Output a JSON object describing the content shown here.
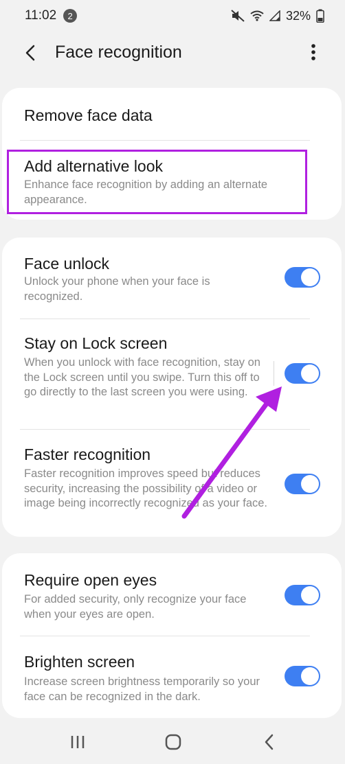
{
  "status_bar": {
    "time": "11:02",
    "notification_count": "2",
    "battery": "32%"
  },
  "app_bar": {
    "title": "Face recognition"
  },
  "card1": {
    "remove_face_data": {
      "title": "Remove face data"
    },
    "add_alternative_look": {
      "title": "Add alternative look",
      "subtitle": "Enhance face recognition by adding an alternate appearance."
    }
  },
  "card2": {
    "face_unlock": {
      "title": "Face unlock",
      "subtitle": "Unlock your phone when your face is recognized.",
      "enabled": true
    },
    "stay_on_lock_screen": {
      "title": "Stay on Lock screen",
      "subtitle": "When you unlock with face recognition, stay on the Lock screen until you swipe. Turn this off to go directly to the last screen you were using.",
      "enabled": true
    },
    "faster_recognition": {
      "title": "Faster recognition",
      "subtitle": "Faster recognition improves speed but reduces security, increasing the possibility of a video or image being incorrectly recognized as your face.",
      "enabled": true
    }
  },
  "card3": {
    "require_open_eyes": {
      "title": "Require open eyes",
      "subtitle": "For added security, only recognize your face when your eyes are open.",
      "enabled": true
    },
    "brighten_screen": {
      "title": "Brighten screen",
      "subtitle": "Increase screen brightness temporarily so your face can be recognized in the dark.",
      "enabled": true
    }
  },
  "icons": {
    "back": "chevron-left-icon",
    "more": "more-vertical-icon",
    "mute": "mute-icon",
    "wifi": "wifi-icon",
    "signal": "signal-icon",
    "battery": "battery-icon",
    "nav_recents": "recents-icon",
    "nav_home": "home-icon",
    "nav_back": "back-icon"
  },
  "colors": {
    "toggle_on": "#3e7ff2",
    "annotation": "#b020e0",
    "background": "#f2f2f2"
  }
}
